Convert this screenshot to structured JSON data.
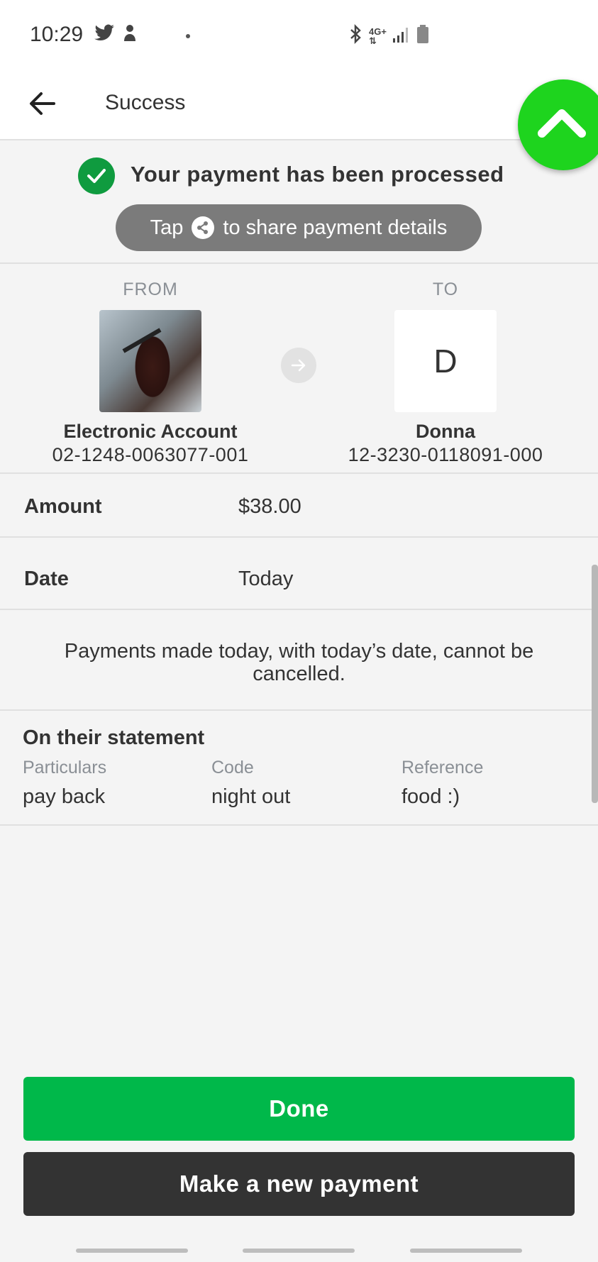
{
  "status_bar": {
    "time": "10:29",
    "network": "4G+",
    "icons_left": [
      "twitter-icon",
      "app-icon"
    ],
    "icons_right": [
      "bluetooth-icon",
      "network-icon",
      "signal-icon",
      "battery-icon"
    ]
  },
  "app_bar": {
    "title": "Success",
    "back_icon": "arrow-left-icon",
    "fab_icon": "chevron-up-icon",
    "fab_color": "#1ed41e"
  },
  "success": {
    "message": "Your payment has been processed",
    "share_prefix": "Tap",
    "share_suffix": "to share payment details",
    "accent": "#0f9b3f"
  },
  "transfer": {
    "from": {
      "label": "FROM",
      "name": "Electronic Account",
      "account": "02-1248-0063077-001"
    },
    "to": {
      "label": "TO",
      "initial": "D",
      "name": "Donna",
      "account": "12-3230-0118091-000"
    }
  },
  "details": {
    "amount_label": "Amount",
    "amount_value": "$38.00",
    "date_label": "Date",
    "date_value": "Today"
  },
  "notice": "Payments made today, with today’s date, cannot be cancelled.",
  "statement": {
    "title": "On their statement",
    "columns": [
      {
        "label": "Particulars",
        "value": "pay back"
      },
      {
        "label": "Code",
        "value": "night out"
      },
      {
        "label": "Reference",
        "value": "food :)"
      }
    ]
  },
  "buttons": {
    "done": "Done",
    "new_payment": "Make a new payment",
    "done_color": "#00b84a",
    "new_color": "#333333"
  }
}
